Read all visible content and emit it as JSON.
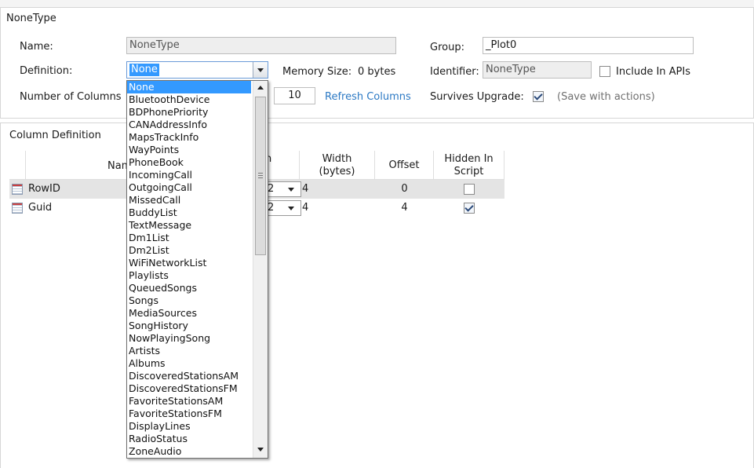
{
  "panel_title": "NoneType",
  "form": {
    "name_label": "Name:",
    "name_value": "NoneType",
    "definition_label": "Definition:",
    "definition_value": "None",
    "num_columns_label": "Number of Columns",
    "num_columns_value": "10",
    "refresh_link": "Refresh Columns",
    "memory_label": "Memory Size:",
    "memory_value": "0 bytes",
    "group_label": "Group:",
    "group_value": "_Plot0",
    "identifier_label": "Identifier:",
    "identifier_value": "NoneType",
    "include_apis_label": "Include In APIs",
    "include_apis_checked": false,
    "survives_label": "Survives Upgrade:",
    "survives_checked": true,
    "save_note": "(Save with actions)"
  },
  "column_panel": {
    "title": "Column Definition",
    "headers": {
      "name": "Nam",
      "type": "n",
      "width_line1": "Width",
      "width_line2": "(bytes)",
      "offset": "Offset",
      "hidden_line1": "Hidden In",
      "hidden_line2": "Script"
    },
    "rows": [
      {
        "name": "RowID",
        "type_tail": "2",
        "width": "4",
        "offset": "0",
        "hidden": false,
        "selected": true
      },
      {
        "name": "Guid",
        "type_tail": "2",
        "width": "4",
        "offset": "4",
        "hidden": true,
        "selected": false
      }
    ]
  },
  "dropdown": {
    "items": [
      "None",
      "BluetoothDevice",
      "BDPhonePriority",
      "CANAddressInfo",
      "MapsTrackInfo",
      "WayPoints",
      "PhoneBook",
      "IncomingCall",
      "OutgoingCall",
      "MissedCall",
      "BuddyList",
      "TextMessage",
      "Dm1List",
      "Dm2List",
      "WiFiNetworkList",
      "Playlists",
      "QueuedSongs",
      "Songs",
      "MediaSources",
      "SongHistory",
      "NowPlayingSong",
      "Artists",
      "Albums",
      "DiscoveredStationsAM",
      "DiscoveredStationsFM",
      "FavoriteStationsAM",
      "FavoriteStationsFM",
      "DisplayLines",
      "RadioStatus",
      "ZoneAudio"
    ],
    "highlighted_index": 0
  },
  "colors": {
    "accent": "#3399ff",
    "link": "#2c79c4"
  }
}
